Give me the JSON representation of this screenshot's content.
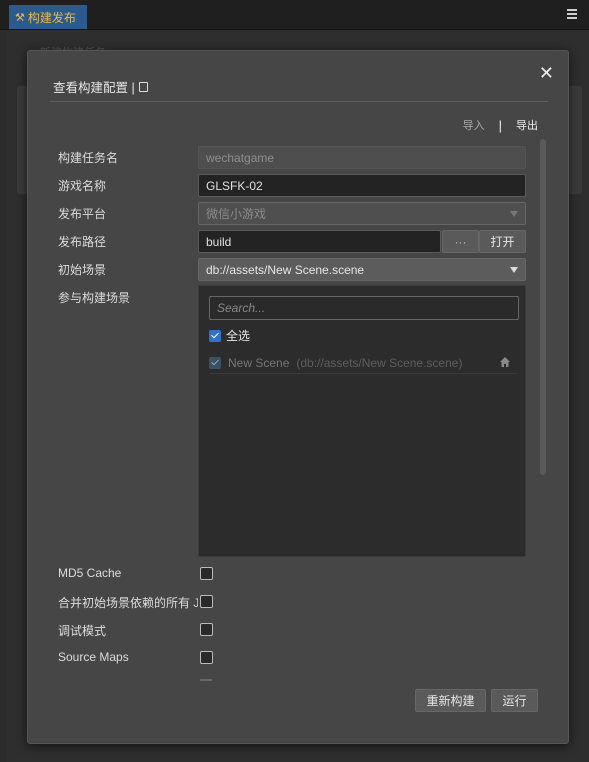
{
  "app": {
    "tab_label": "构建发布",
    "tab_icon": "hammer-icon",
    "menu_icon": "hamburger-menu-icon",
    "background_hint": "新建构建任务"
  },
  "modal": {
    "title": "查看构建配置 |",
    "title_icon": "document-icon",
    "close_icon": "close-icon",
    "import_label": "导入",
    "separator": "|",
    "export_label": "导出"
  },
  "form": {
    "task_name": {
      "label": "构建任务名",
      "value": "wechatgame"
    },
    "game_name": {
      "label": "游戏名称",
      "value": "GLSFK-02"
    },
    "platform": {
      "label": "发布平台",
      "value": "微信小游戏"
    },
    "build_path": {
      "label": "发布路径",
      "value": "build",
      "browse_label": "···",
      "open_label": "打开"
    },
    "start_scene": {
      "label": "初始场景",
      "value": "db://assets/New Scene.scene"
    },
    "scenes": {
      "label": "参与构建场景",
      "search_placeholder": "Search...",
      "select_all_label": "全选",
      "items": [
        {
          "name": "New Scene",
          "path": "(db://assets/New Scene.scene)"
        }
      ]
    },
    "options": [
      {
        "label": "MD5 Cache",
        "checked": false
      },
      {
        "label": "合并初始场景依赖的所有 J",
        "checked": false
      },
      {
        "label": "调试模式",
        "checked": false
      },
      {
        "label": "Source Maps",
        "checked": false
      }
    ]
  },
  "footer": {
    "rebuild_label": "重新构建",
    "run_label": "运行"
  },
  "colors": {
    "tab_bg": "#2d5a8e",
    "tab_text": "#e8b94a",
    "checkbox_checked": "#2f73c7",
    "modal_bg": "#464646"
  }
}
